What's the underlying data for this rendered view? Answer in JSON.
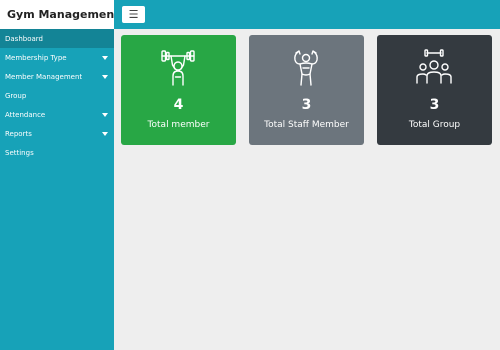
{
  "app": {
    "title": "Gym Management"
  },
  "header": {
    "menu_icon": "☰"
  },
  "sidebar": {
    "items": [
      {
        "label": "Dashboard",
        "active": true,
        "has_caret": false
      },
      {
        "label": "Membership Type",
        "active": false,
        "has_caret": true
      },
      {
        "label": "Member Management",
        "active": false,
        "has_caret": true
      },
      {
        "label": "Group",
        "active": false,
        "has_caret": false
      },
      {
        "label": "Attendance",
        "active": false,
        "has_caret": true
      },
      {
        "label": "Reports",
        "active": false,
        "has_caret": true
      },
      {
        "label": "Settings",
        "active": false,
        "has_caret": false
      }
    ]
  },
  "cards": [
    {
      "count": "4",
      "label": "Total member",
      "icon": "weightlifter-icon",
      "color": "#28a745"
    },
    {
      "count": "3",
      "label": "Total Staff Member",
      "icon": "bodybuilder-icon",
      "color": "#6c757d"
    },
    {
      "count": "3",
      "label": "Total Group",
      "icon": "group-icon",
      "color": "#343a40"
    }
  ],
  "colors": {
    "primary": "#17a2b8",
    "active": "#138496",
    "background": "#eeeeee"
  }
}
